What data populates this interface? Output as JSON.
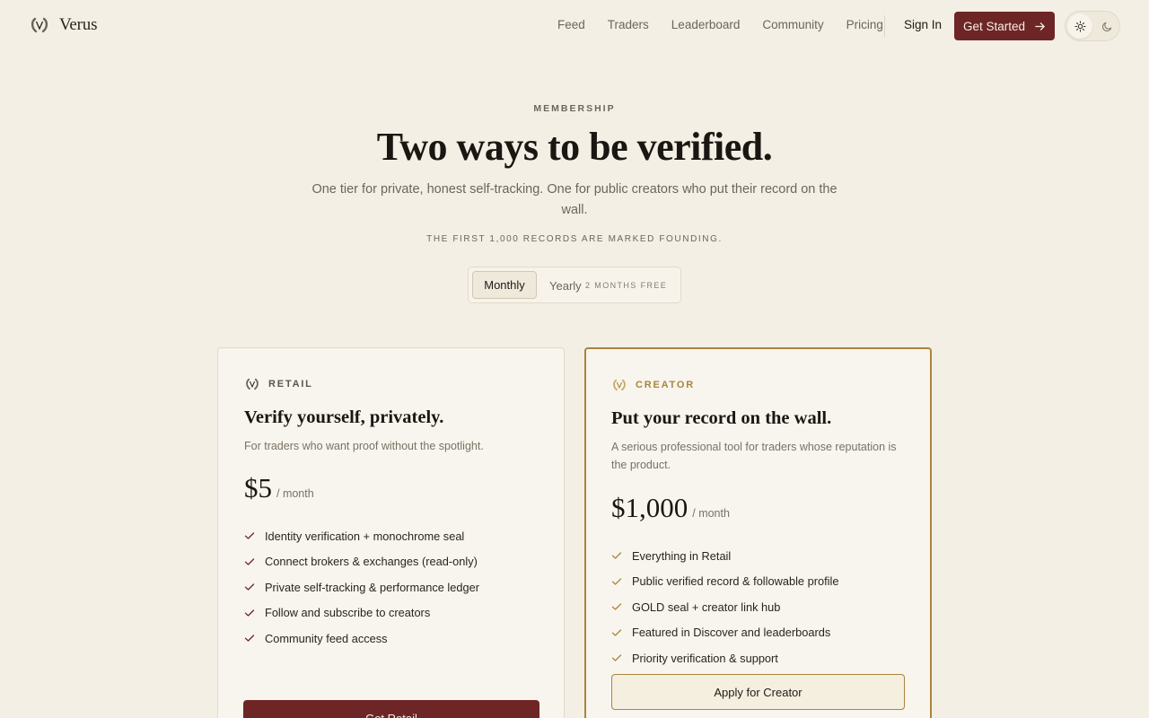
{
  "brand": {
    "name": "Verus",
    "logo_icon": "laurel-v-icon"
  },
  "nav": {
    "links": [
      "Feed",
      "Traders",
      "Leaderboard",
      "Community",
      "Pricing"
    ],
    "sign_in": "Sign In",
    "get_started": "Get Started",
    "theme": {
      "light_icon": "sun-icon",
      "dark_icon": "moon-icon",
      "selected": "light"
    }
  },
  "hero": {
    "eyebrow": "MEMBERSHIP",
    "title": "Two ways to be verified.",
    "subtitle": "One tier for private, honest self-tracking. One for public creators who put their record on the wall.",
    "note": "THE FIRST 1,000 RECORDS ARE MARKED FOUNDING."
  },
  "billing": {
    "options": [
      "Monthly",
      "Yearly"
    ],
    "selected": "Monthly",
    "yearly_badge": "2 MONTHS FREE"
  },
  "plans": {
    "retail": {
      "tier": "RETAIL",
      "title": "Verify yourself, privately.",
      "description": "For traders who want proof without the spotlight.",
      "price": "$5",
      "unit": "/ month",
      "features": [
        "Identity verification + monochrome seal",
        "Connect brokers & exchanges (read-only)",
        "Private self-tracking & performance ledger",
        "Follow and subscribe to creators",
        "Community feed access"
      ],
      "cta": "Get Retail"
    },
    "creator": {
      "tier": "CREATOR",
      "title": "Put your record on the wall.",
      "description": "A serious professional tool for traders whose reputation is the product.",
      "price": "$1,000",
      "unit": "/ month",
      "features": [
        "Everything in Retail",
        "Public verified record & followable profile",
        "GOLD seal + creator link hub",
        "Featured in Discover and leaderboards",
        "Priority verification & support"
      ],
      "cta": "Apply for Creator"
    }
  },
  "colors": {
    "background": "#f3efe4",
    "accent_burgundy": "#6e2526",
    "accent_gold": "#a9853e",
    "text_muted": "#6d655a"
  }
}
